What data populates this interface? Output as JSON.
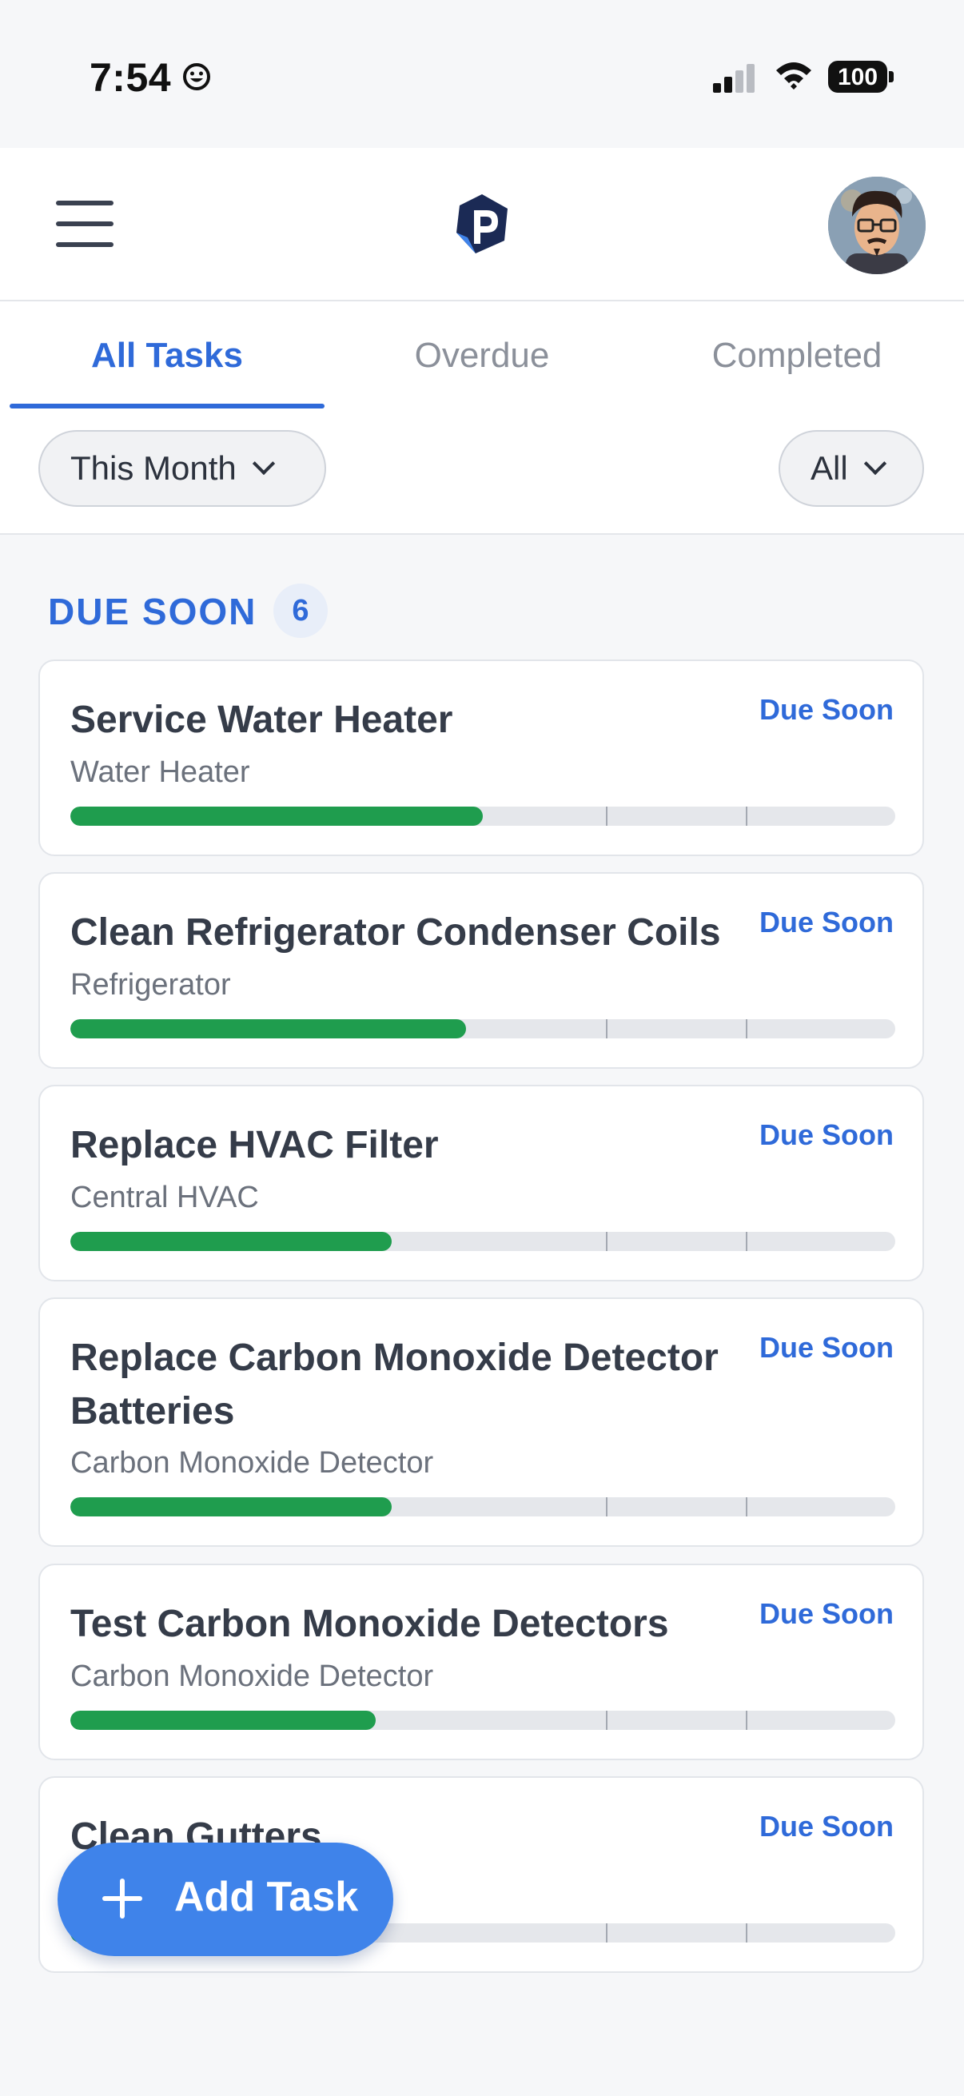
{
  "status_bar": {
    "time": "7:54",
    "battery": "100"
  },
  "tabs": [
    {
      "label": "All Tasks",
      "active": true
    },
    {
      "label": "Overdue",
      "active": false
    },
    {
      "label": "Completed",
      "active": false
    }
  ],
  "filters": {
    "period": "This Month",
    "category": "All"
  },
  "section": {
    "title": "DUE SOON",
    "count": "6"
  },
  "tasks": [
    {
      "title": "Service Water Heater",
      "subtitle": "Water Heater",
      "status": "Due Soon",
      "progress": 0.5
    },
    {
      "title": "Clean Refrigerator Condenser Coils",
      "subtitle": "Refrigerator",
      "status": "Due Soon",
      "progress": 0.48
    },
    {
      "title": "Replace HVAC Filter",
      "subtitle": "Central HVAC",
      "status": "Due Soon",
      "progress": 0.39
    },
    {
      "title": "Replace Carbon Monoxide Detector Batteries",
      "subtitle": "Carbon Monoxide Detector",
      "status": "Due Soon",
      "progress": 0.39
    },
    {
      "title": "Test Carbon Monoxide Detectors",
      "subtitle": "Carbon Monoxide Detector",
      "status": "Due Soon",
      "progress": 0.37
    },
    {
      "title": "Clean Gutters",
      "subtitle": "",
      "status": "Due Soon",
      "progress": 0.3
    }
  ],
  "fab": {
    "label": "Add Task"
  },
  "colors": {
    "accent": "#2f6ad9",
    "progress": "#1f9d4e",
    "fab": "#3f83ea"
  }
}
